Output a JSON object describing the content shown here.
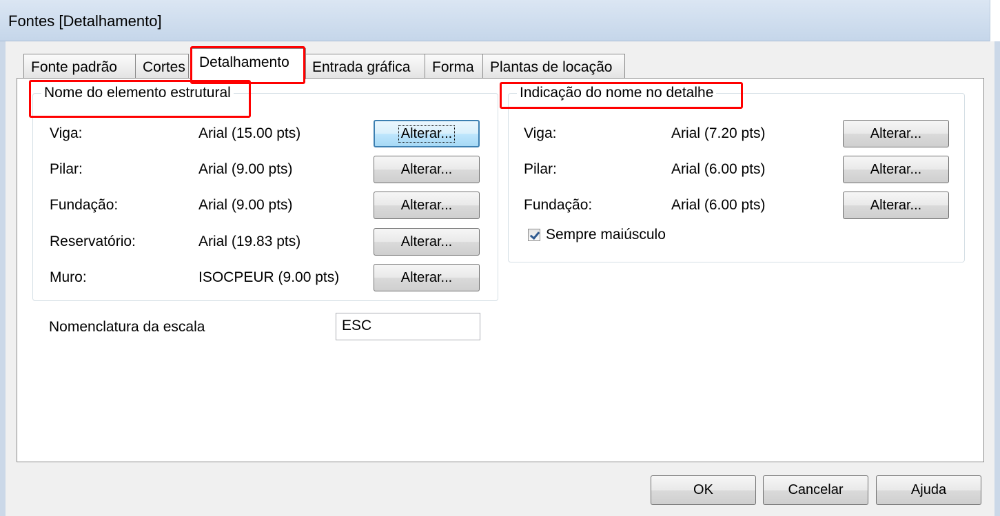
{
  "window": {
    "title": "Fontes [Detalhamento]"
  },
  "tabs": [
    {
      "label": "Fonte padrão",
      "active": false
    },
    {
      "label": "Cortes",
      "active": false
    },
    {
      "label": "Detalhamento",
      "active": true
    },
    {
      "label": "Entrada gráfica",
      "active": false
    },
    {
      "label": "Forma",
      "active": false
    },
    {
      "label": "Plantas de locação",
      "active": false
    }
  ],
  "left_group": {
    "legend": "Nome do elemento estrutural",
    "rows": [
      {
        "label": "Viga:",
        "value": "Arial (15.00 pts)",
        "button": "Alterar..."
      },
      {
        "label": "Pilar:",
        "value": "Arial (9.00 pts)",
        "button": "Alterar..."
      },
      {
        "label": "Fundação:",
        "value": "Arial (9.00 pts)",
        "button": "Alterar..."
      },
      {
        "label": "Reservatório:",
        "value": "Arial (19.83 pts)",
        "button": "Alterar..."
      },
      {
        "label": "Muro:",
        "value": "ISOCPEUR (9.00 pts)",
        "button": "Alterar..."
      }
    ]
  },
  "right_group": {
    "legend": "Indicação do nome no detalhe",
    "rows": [
      {
        "label": "Viga:",
        "value": "Arial (7.20 pts)",
        "button": "Alterar..."
      },
      {
        "label": "Pilar:",
        "value": "Arial (6.00 pts)",
        "button": "Alterar..."
      },
      {
        "label": "Fundação:",
        "value": "Arial (6.00 pts)",
        "button": "Alterar..."
      }
    ],
    "checkbox": {
      "label": "Sempre maiúsculo",
      "checked": true
    }
  },
  "scale": {
    "label": "Nomenclatura da escala",
    "value": "ESC"
  },
  "footer": {
    "ok": "OK",
    "cancel": "Cancelar",
    "help": "Ajuda"
  },
  "colors": {
    "highlight": "#ff0000",
    "focus": "#3c7fb1"
  }
}
